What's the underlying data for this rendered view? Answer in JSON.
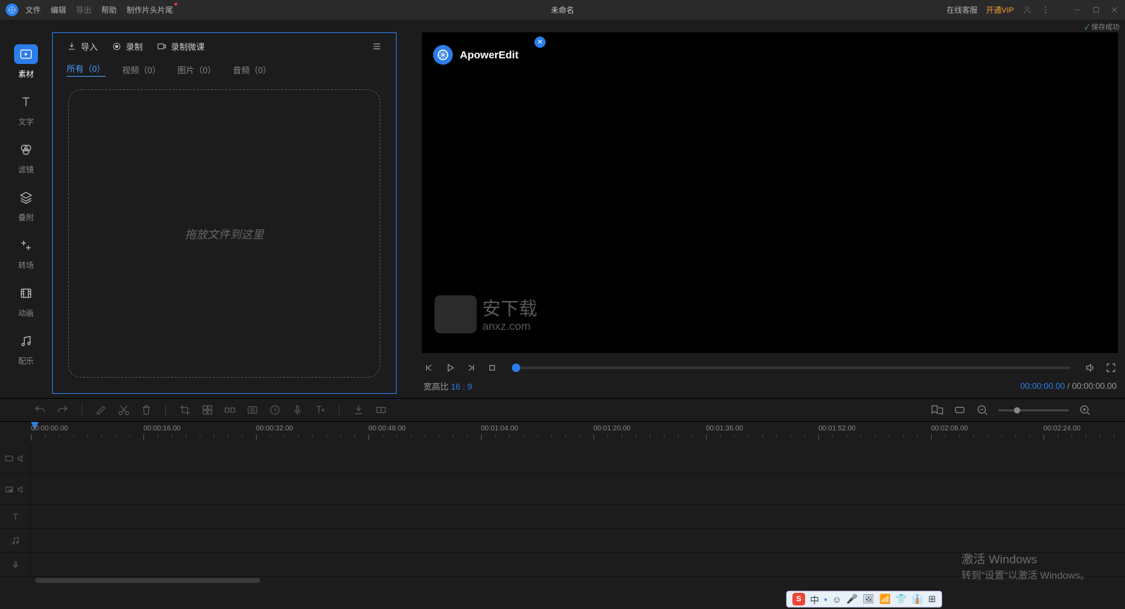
{
  "titlebar": {
    "menus": [
      "文件",
      "编辑",
      "导出",
      "帮助",
      "制作片头片尾"
    ],
    "dim_index": 2,
    "title": "未命名",
    "customer_service": "在线客服",
    "vip": "开通VIP"
  },
  "save_status": "保存成功",
  "sidebar": [
    {
      "label": "素材",
      "icon": "play"
    },
    {
      "label": "文字",
      "icon": "text"
    },
    {
      "label": "滤镜",
      "icon": "filter"
    },
    {
      "label": "叠附",
      "icon": "layers"
    },
    {
      "label": "转场",
      "icon": "transition"
    },
    {
      "label": "动画",
      "icon": "film"
    },
    {
      "label": "配乐",
      "icon": "music"
    }
  ],
  "media": {
    "tools": {
      "import": "导入",
      "record": "录制",
      "lesson": "录制微课"
    },
    "filters": [
      {
        "label": "所有（0）",
        "active": true
      },
      {
        "label": "视频（0）"
      },
      {
        "label": "图片（0）"
      },
      {
        "label": "音频（0）"
      }
    ],
    "dropzone": "拖放文件到这里"
  },
  "preview": {
    "brand": "ApowerEdit",
    "watermark_main": "安下载",
    "watermark_sub": "anxz.com",
    "aspect_label": "宽高比",
    "aspect_value": "16 : 9",
    "time_current": "00:00:00.00",
    "time_total": "00:00:00.00"
  },
  "ruler": [
    "00:00:00.00",
    "00:00:16.00",
    "00:00:32.00",
    "00:00:48.00",
    "00:01:04.00",
    "00:01:20.00",
    "00:01:36.00",
    "00:01:52.00",
    "00:02:08.00",
    "00:02:24.00"
  ],
  "windows": {
    "l1": "激活 Windows",
    "l2": "转到\"设置\"以激活 Windows。"
  },
  "ime": {
    "brand": "S",
    "items": [
      "中",
      "☺",
      "🎤",
      "🖼",
      "📶",
      "👕",
      "👔",
      "⊞"
    ]
  }
}
